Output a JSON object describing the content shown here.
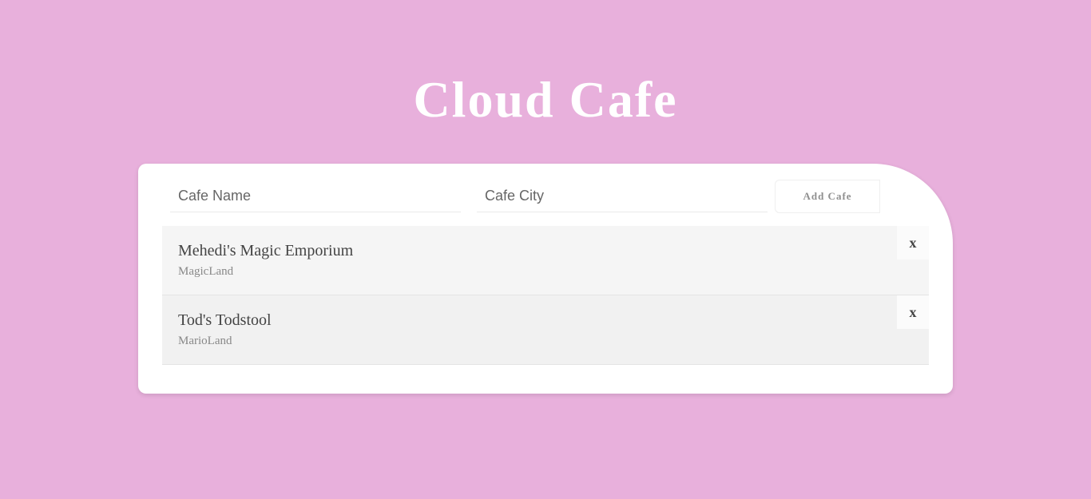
{
  "title": "Cloud Cafe",
  "form": {
    "name_placeholder": "Cafe Name",
    "city_placeholder": "Cafe City",
    "submit_label": "Add Cafe"
  },
  "cafes": [
    {
      "name": "Mehedi's Magic Emporium",
      "city": "MagicLand",
      "delete_label": "x"
    },
    {
      "name": "Tod's Todstool",
      "city": "MarioLand",
      "delete_label": "x"
    }
  ],
  "colors": {
    "background": "#e8b0dc",
    "card": "#ffffff",
    "title": "#ffffff"
  }
}
